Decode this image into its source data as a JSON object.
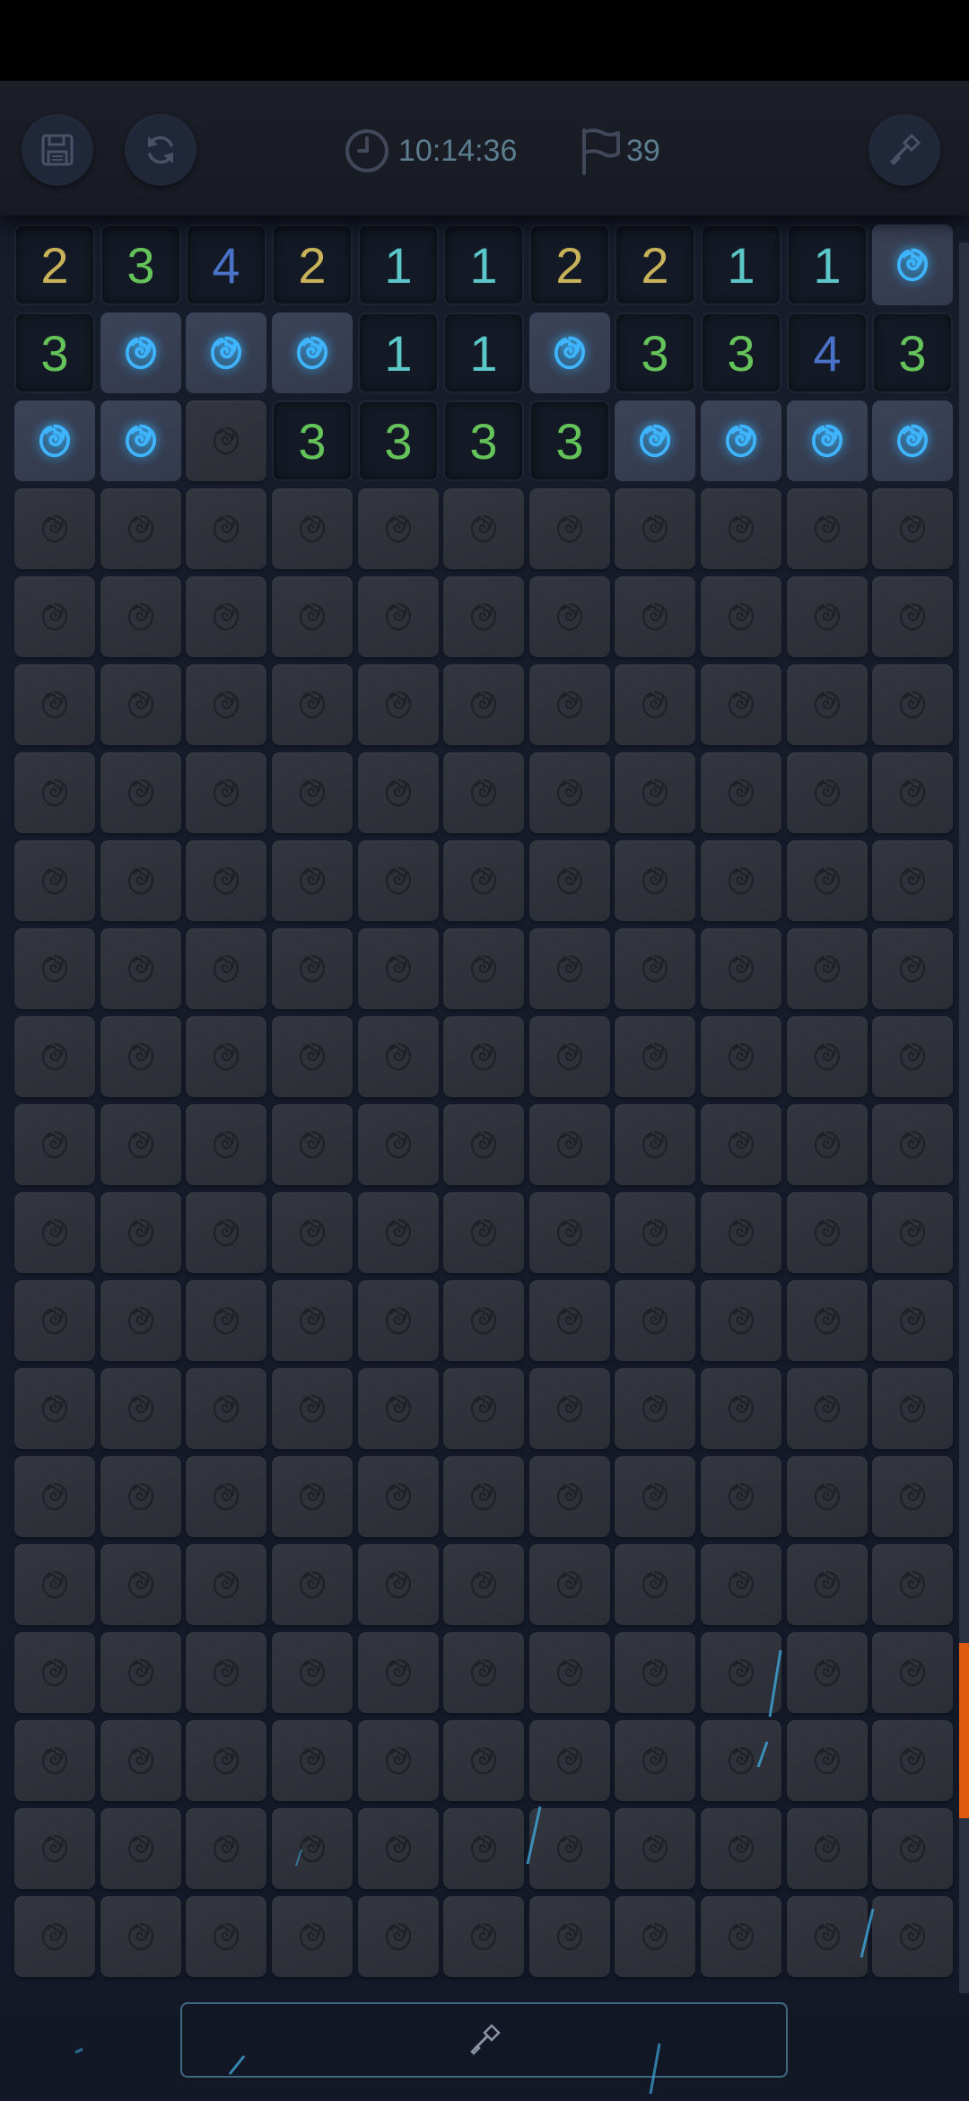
{
  "hud": {
    "timer": "10:14:36",
    "flags_remaining": "39",
    "icons": {
      "save": "save-icon",
      "restart": "restart-icon",
      "timer": "clock-icon",
      "flags": "flag-icon",
      "tool": "shovel-icon"
    }
  },
  "board": {
    "rows": 20,
    "cols": 11,
    "revealed_rows": [
      [
        "2",
        "3",
        "4",
        "2",
        "1",
        "1",
        "2",
        "2",
        "1",
        "1",
        "M"
      ],
      [
        "3",
        "M",
        "M",
        "M",
        "1",
        "1",
        "M",
        "3",
        "3",
        "4",
        "3"
      ],
      [
        "M",
        "M",
        "H",
        "3",
        "3",
        "3",
        "3",
        "M",
        "M",
        "M",
        "M"
      ]
    ],
    "legend": {
      "H": "hidden cell",
      "M": "revealed rose mine"
    },
    "number_colors": {
      "1": "#5cc7c9",
      "2": "#c8b25a",
      "3": "#64c45a",
      "4": "#4a72c8"
    },
    "mine_color": "#3fb4ff",
    "hidden_icon": "rose-icon",
    "mine_icon": "rose-icon"
  },
  "scroll": {
    "position": 0.9,
    "accent": "#e05a10"
  },
  "bottom": {
    "mode_icon": "shovel-icon"
  }
}
